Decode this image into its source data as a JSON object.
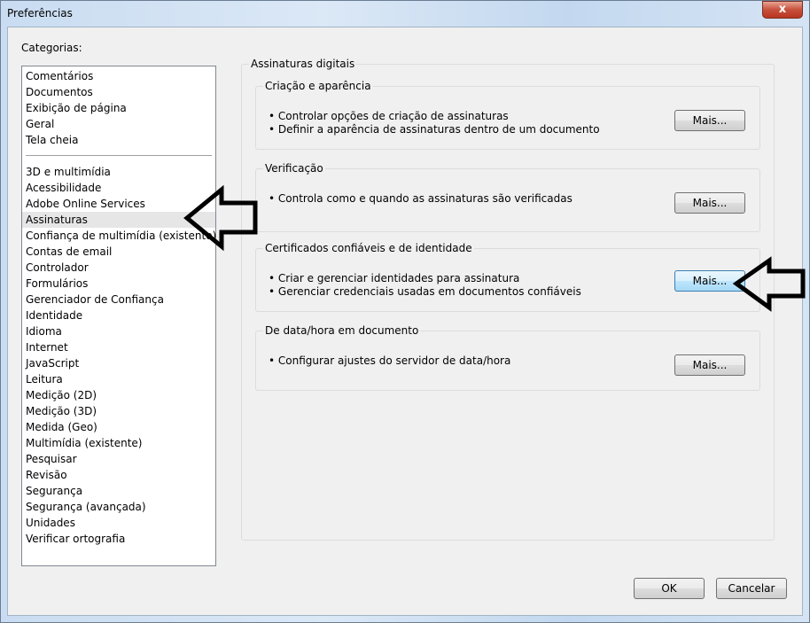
{
  "window": {
    "title": "Preferências",
    "close_label": "x"
  },
  "categories_label": "Categorias:",
  "categories_top": [
    "Comentários",
    "Documentos",
    "Exibição de página",
    "Geral",
    "Tela cheia"
  ],
  "categories": [
    "3D e multimídia",
    "Acessibilidade",
    "Adobe Online Services",
    "Assinaturas",
    "Confiança de multimídia (existente)",
    "Contas de email",
    "Controlador",
    "Formulários",
    "Gerenciador de Confiança",
    "Identidade",
    "Idioma",
    "Internet",
    "JavaScript",
    "Leitura",
    "Medição (2D)",
    "Medição (3D)",
    "Medida (Geo)",
    "Multimídia (existente)",
    "Pesquisar",
    "Revisão",
    "Segurança",
    "Segurança (avançada)",
    "Unidades",
    "Verificar ortografia"
  ],
  "selected_category": "Assinaturas",
  "panel": {
    "title": "Assinaturas digitais",
    "sections": [
      {
        "title": "Criação e aparência",
        "bullets": [
          "• Controlar opções de criação de assinaturas",
          "• Definir a aparência de assinaturas dentro de um documento"
        ],
        "button": "Mais..."
      },
      {
        "title": "Verificação",
        "bullets": [
          "• Controla como e quando as assinaturas são verificadas"
        ],
        "button": "Mais..."
      },
      {
        "title": "Certificados confiáveis e de identidade",
        "bullets": [
          "• Criar e gerenciar identidades para assinatura",
          "• Gerenciar credenciais usadas em documentos confiáveis"
        ],
        "button": "Mais..."
      },
      {
        "title": "De data/hora em documento",
        "bullets": [
          "• Configurar ajustes do servidor de data/hora"
        ],
        "button": "Mais..."
      }
    ]
  },
  "footer": {
    "ok": "OK",
    "cancel": "Cancelar"
  }
}
